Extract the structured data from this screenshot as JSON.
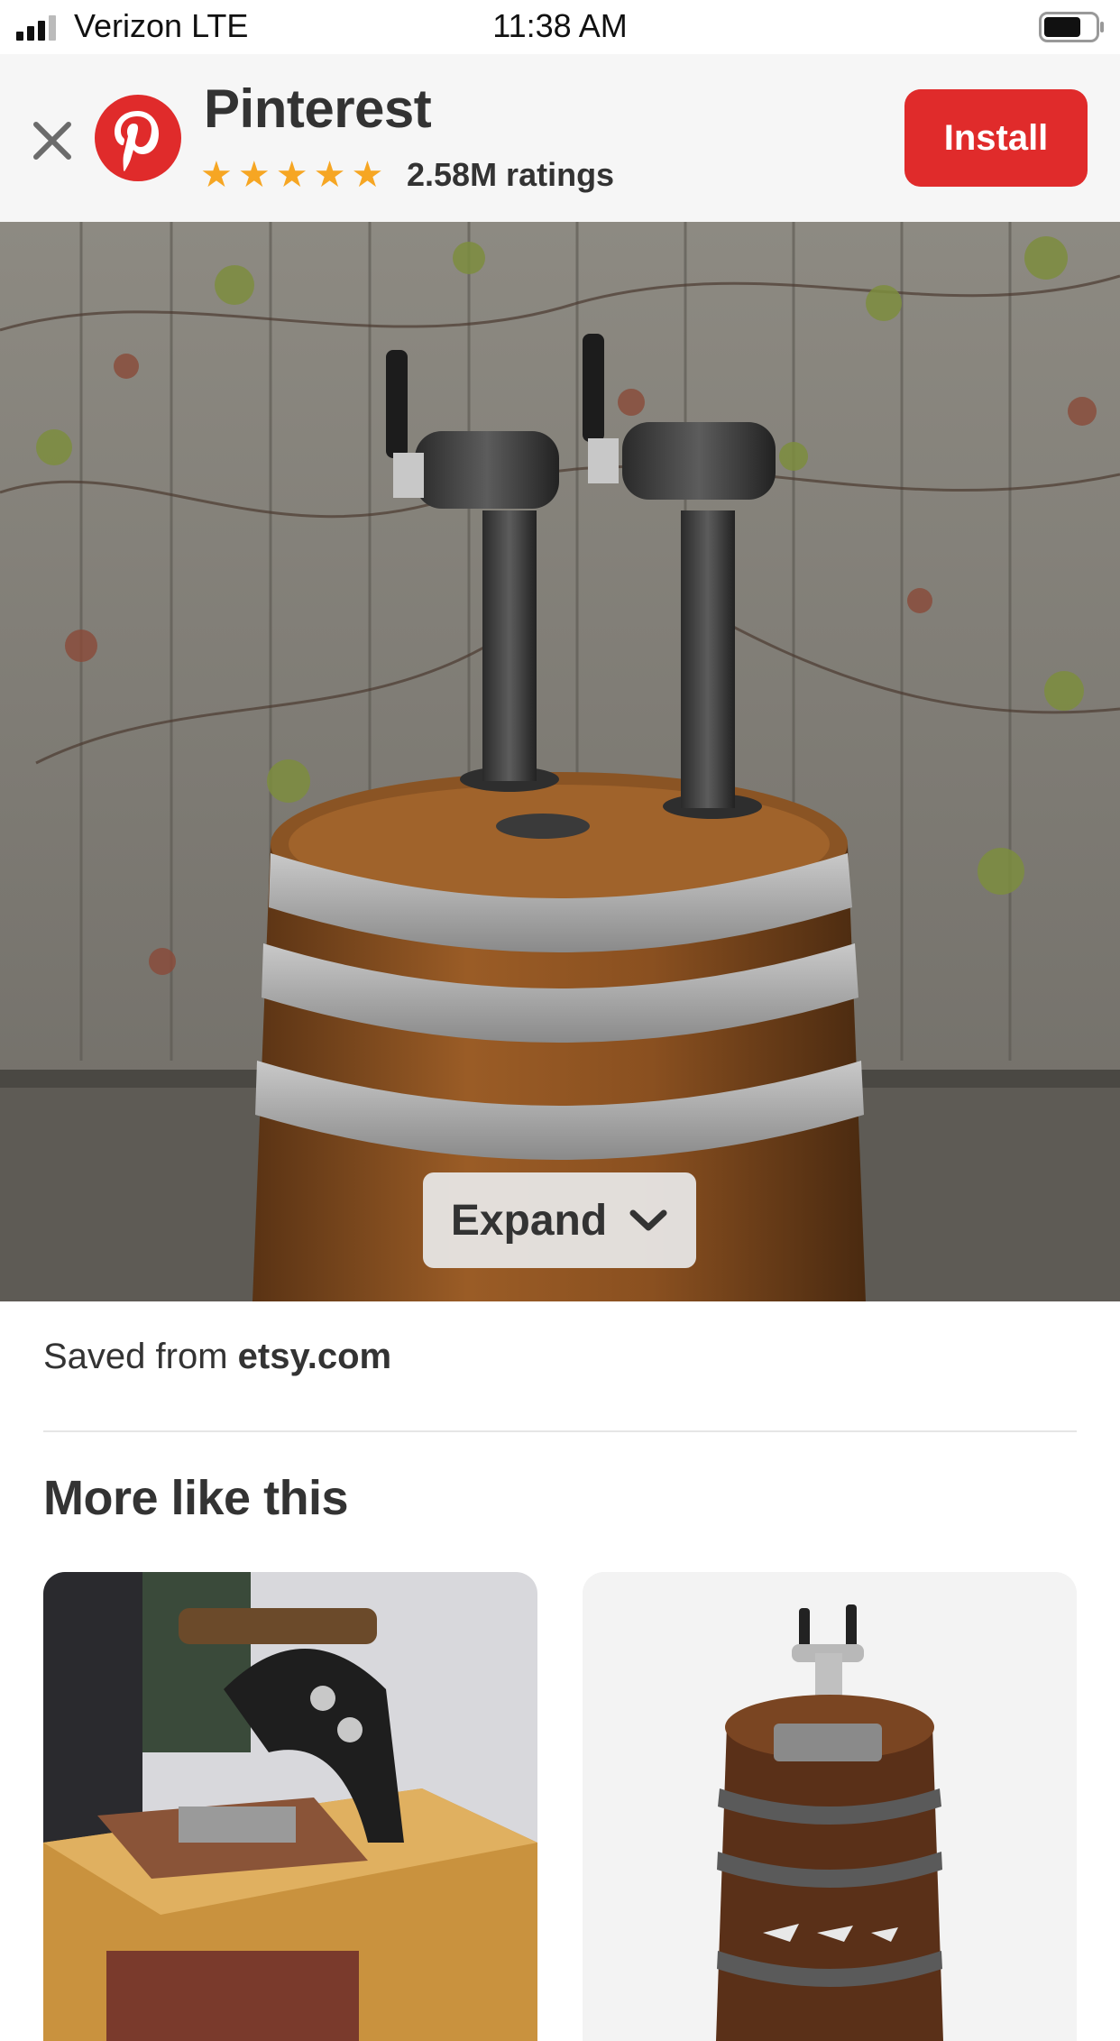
{
  "status_bar": {
    "carrier": "Verizon  LTE",
    "time": "11:38 AM"
  },
  "banner": {
    "app_name": "Pinterest",
    "rating_stars": 5,
    "ratings_text": "2.58M ratings",
    "install_label": "Install",
    "brand_color": "#e02b2b",
    "star_color": "#f6a623"
  },
  "pin": {
    "expand_label": "Expand",
    "saved_prefix": "Saved from",
    "saved_domain": "etsy.com"
  },
  "more": {
    "title": "More like this"
  }
}
